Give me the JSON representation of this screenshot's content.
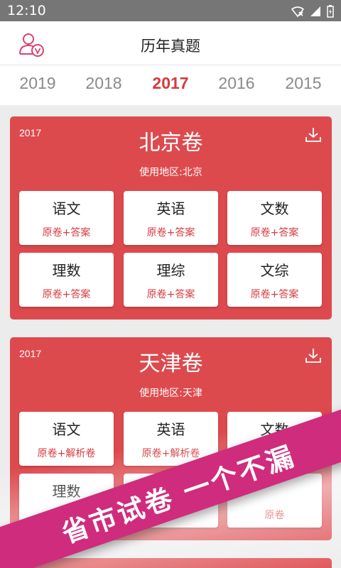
{
  "status_bar": {
    "time": "12:10",
    "icons": [
      "wifi-off-icon",
      "signal-icon",
      "battery-charging-icon"
    ]
  },
  "header": {
    "title": "历年真题",
    "avatar_icon": "vip-user-icon"
  },
  "year_tabs": {
    "items": [
      "2019",
      "2018",
      "2017",
      "2016",
      "2015"
    ],
    "active": "2017"
  },
  "cards": [
    {
      "year": "2017",
      "title": "北京卷",
      "region": "使用地区:北京",
      "subjects": [
        {
          "name": "语文",
          "type": "原卷+答案"
        },
        {
          "name": "英语",
          "type": "原卷+答案"
        },
        {
          "name": "文数",
          "type": "原卷+答案"
        },
        {
          "name": "理数",
          "type": "原卷+答案"
        },
        {
          "name": "理综",
          "type": "原卷+答案"
        },
        {
          "name": "文综",
          "type": "原卷+答案"
        }
      ]
    },
    {
      "year": "2017",
      "title": "天津卷",
      "region": "使用地区:天津",
      "subjects": [
        {
          "name": "语文",
          "type": "原卷+解析卷"
        },
        {
          "name": "英语",
          "type": "原卷+解析卷"
        },
        {
          "name": "文数",
          "type": "原卷"
        },
        {
          "name": "理数",
          "type": ""
        },
        {
          "name": "",
          "type": ""
        },
        {
          "name": "",
          "type": "原卷"
        }
      ]
    }
  ],
  "promo": {
    "text": "省市试卷  一个不漏"
  },
  "colors": {
    "accent": "#d63a3e",
    "card": "#dd4a4e",
    "banner": "#cf2c7d"
  }
}
